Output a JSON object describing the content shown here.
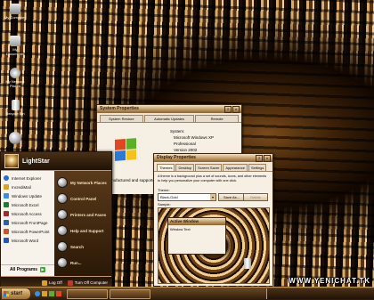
{
  "desktop": {
    "icons": [
      {
        "label": "My Computer",
        "icon": "computer-icon"
      },
      {
        "label": "My Documents",
        "icon": "documents-folder-icon"
      },
      {
        "label": "My Network Places",
        "icon": "network-places-icon"
      },
      {
        "label": "Recycle Bin",
        "icon": "recycle-bin-icon"
      },
      {
        "label": "",
        "icon": "globe-icon"
      }
    ],
    "watermark": "WWW.YENICHAT.TK"
  },
  "system_properties": {
    "title": "System Properties",
    "tabs": [
      "System Restore",
      "Automatic Updates",
      "Remote"
    ],
    "system_label": "System:",
    "lines": [
      "Microsoft Windows XP",
      "Professional",
      "Version 2002"
    ],
    "manufacturer_text": "Manufactured and supported by:"
  },
  "display_properties": {
    "title": "Display Properties",
    "tabs": [
      "Themes",
      "Desktop",
      "Screen Saver",
      "Appearance",
      "Settings"
    ],
    "description": "A theme is a background plus a set of sounds, icons, and other elements to help you personalize your computer with one click.",
    "theme_label": "Theme:",
    "theme_value": "Black-Gold",
    "save_as_label": "Save As...",
    "delete_label": "Delete",
    "sample_label": "Sample:",
    "preview_window_title": "Active Window",
    "preview_window_text": "Window Text"
  },
  "start_menu": {
    "user_name": "LightStar",
    "left_items": [
      {
        "label": "Internet Explorer",
        "color": "#2a6bd1"
      },
      {
        "label": "IncrediMail",
        "color": "#d9a126"
      },
      {
        "label": "Windows Update",
        "color": "#3a8ee6"
      },
      {
        "label": "Microsoft Excel",
        "color": "#1f7a34"
      },
      {
        "label": "Microsoft Access",
        "color": "#9e2b2b"
      },
      {
        "label": "Microsoft FrontPage",
        "color": "#2e5fa8"
      },
      {
        "label": "Microsoft PowerPoint",
        "color": "#c8552a"
      },
      {
        "label": "Microsoft Word",
        "color": "#2a56b0"
      }
    ],
    "right_items": [
      "My Network Places",
      "Control Panel",
      "Printers and Faxes",
      "Help and Support",
      "Search",
      "Run..."
    ],
    "all_programs_label": "All Programs",
    "logoff_label": "Log Off",
    "turnoff_label": "Turn Off Computer"
  },
  "taskbar": {
    "start_label": "start"
  }
}
